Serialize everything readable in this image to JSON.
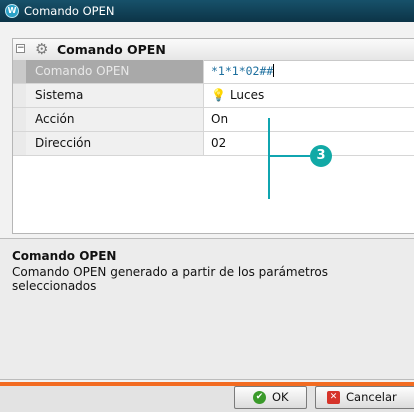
{
  "window": {
    "title": "Comando OPEN",
    "app_icon_name": "app-logo-icon"
  },
  "property_grid": {
    "title": "Comando OPEN",
    "collapse_symbol": "−",
    "rows": [
      {
        "name": "Comando OPEN",
        "value": "*1*1*02##",
        "selected": true
      },
      {
        "name": "Sistema",
        "value": "Luces",
        "icon": "bulb-icon"
      },
      {
        "name": "Acción",
        "value": "On"
      },
      {
        "name": "Dirección",
        "value": "02"
      }
    ]
  },
  "callout": {
    "number": "3",
    "color": "#10a5b0"
  },
  "description": {
    "title": "Comando OPEN",
    "text": "Comando OPEN generado a partir de los parámetros seleccionados"
  },
  "footer": {
    "accent_color": "#f26b21",
    "ok_label": "OK",
    "cancel_label": "Cancelar"
  }
}
